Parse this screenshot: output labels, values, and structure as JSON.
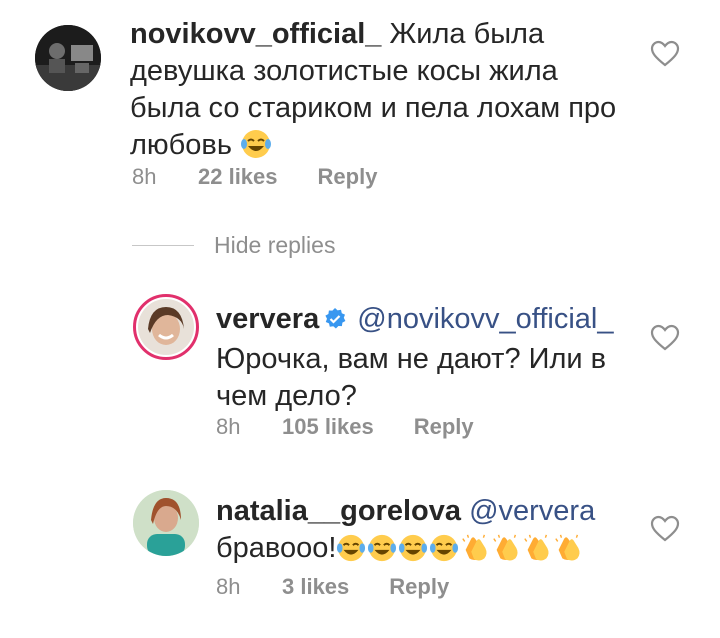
{
  "comments": [
    {
      "username": "novikovv_official_",
      "text_line1": "Жила была",
      "text_line2": "девушка золотистые косы жила",
      "text_line3": "была со стариком и пела лохам про",
      "text_line4": "любовь",
      "emoji": "laughing-tears",
      "time": "8h",
      "likes": "22 likes",
      "reply": "Reply"
    },
    {
      "username": "ververa",
      "verified": true,
      "mention": "@novikovv_official_",
      "text_line1": "Юрочка, вам не дают? Или в",
      "text_line2": "чем дело?",
      "time": "8h",
      "likes": "105 likes",
      "reply": "Reply"
    },
    {
      "username": "natalia__gorelova",
      "mention": "@ververa",
      "text_line1": "бравооо!",
      "emojis": [
        "laughing-tears",
        "laughing-tears",
        "laughing-tears",
        "laughing-tears",
        "clapping-hands",
        "clapping-hands",
        "clapping-hands",
        "clapping-hands"
      ],
      "time": "8h",
      "likes": "3 likes",
      "reply": "Reply"
    }
  ],
  "hide_replies": "Hide replies",
  "colors": {
    "text": "#262626",
    "meta": "#8e8e8e",
    "mention": "#385185",
    "verified": "#3897f0"
  }
}
